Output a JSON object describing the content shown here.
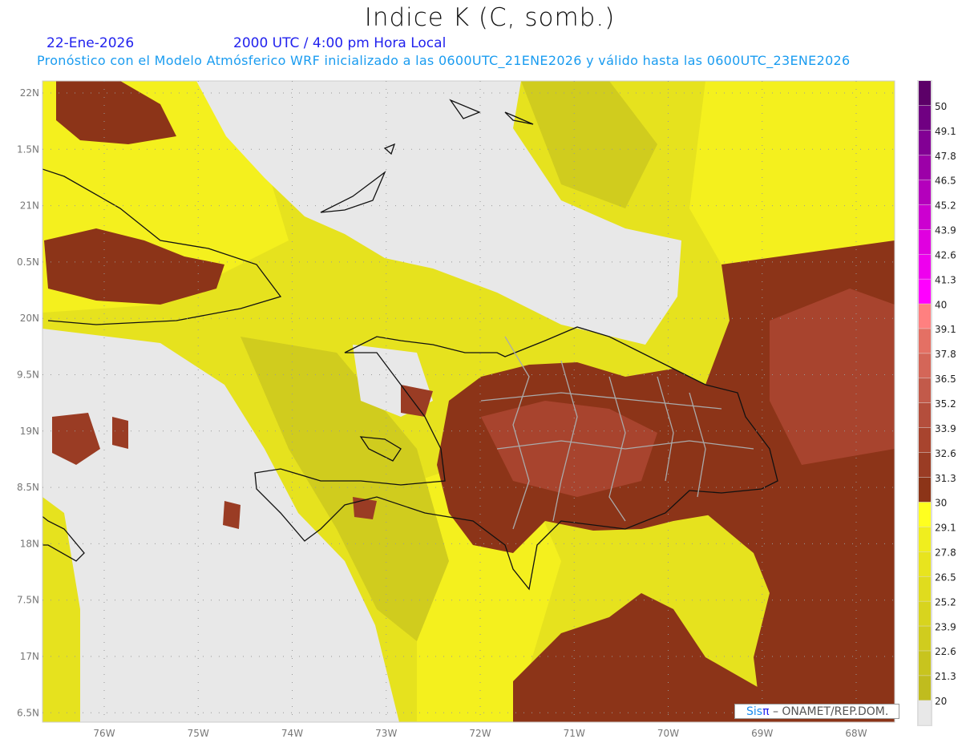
{
  "header": {
    "title": "Indice K (C, somb.)",
    "date": "22-Ene-2026",
    "time": "2000 UTC / 4:00 pm Hora Local",
    "subtitle": "Pronóstico con el Modelo Atmósferico WRF inicializado a las 0600UTC_21ENE2026 y válido hasta las  0600UTC_23ENE2026"
  },
  "map": {
    "lon_ticks": [
      {
        "value": -76,
        "label": "76W"
      },
      {
        "value": -75,
        "label": "75W"
      },
      {
        "value": -74,
        "label": "74W"
      },
      {
        "value": -73,
        "label": "73W"
      },
      {
        "value": -72,
        "label": "72W"
      },
      {
        "value": -71,
        "label": "71W"
      },
      {
        "value": -70,
        "label": "70W"
      },
      {
        "value": -69,
        "label": "69W"
      },
      {
        "value": -68,
        "label": "68W"
      }
    ],
    "lat_ticks": [
      {
        "value": 22,
        "label": "22N"
      },
      {
        "value": 21.5,
        "label": "1.5N"
      },
      {
        "value": 21,
        "label": "21N"
      },
      {
        "value": 20.5,
        "label": "0.5N"
      },
      {
        "value": 20,
        "label": "20N"
      },
      {
        "value": 19.5,
        "label": "9.5N"
      },
      {
        "value": 19,
        "label": "19N"
      },
      {
        "value": 18.5,
        "label": "8.5N"
      },
      {
        "value": 18,
        "label": "18N"
      },
      {
        "value": 17.5,
        "label": "7.5N"
      },
      {
        "value": 17,
        "label": "17N"
      },
      {
        "value": 16.5,
        "label": "6.5N"
      }
    ]
  },
  "colorbar": {
    "labels": [
      "20",
      "21.3",
      "22.6",
      "23.9",
      "25.2",
      "26.5",
      "27.8",
      "29.1",
      "30",
      "31.3",
      "32.6",
      "33.9",
      "35.2",
      "36.5",
      "37.8",
      "39.1",
      "40",
      "41.3",
      "42.6",
      "43.9",
      "45.2",
      "46.5",
      "47.8",
      "49.1",
      "50"
    ],
    "colors": [
      "#e8e8e8",
      "#c0bc1e",
      "#c8c41e",
      "#d0cc1e",
      "#d8d41e",
      "#e0dc1e",
      "#e8e41e",
      "#f0ee1e",
      "#ffff20",
      "#8c3418",
      "#9a3c24",
      "#a8442e",
      "#b44e3c",
      "#c25a4a",
      "#d46658",
      "#e47064",
      "#ff8080",
      "#ff00ff",
      "#ee00ee",
      "#e000e0",
      "#cc00d0",
      "#b400bc",
      "#9c00a8",
      "#820094",
      "#700082",
      "#5c0068"
    ]
  },
  "field_colors": {
    "below": "#e8e8e8",
    "yellow_dark": "#c8c41e",
    "yellow": "#e6e21e",
    "yellow_bright": "#ffff20",
    "brown": "#8c3418",
    "brown_light": "#a8442e"
  },
  "credit": {
    "brand_a": "Sis",
    "brand_b": "π",
    "text": " –  ONAMET/REP.DOM."
  }
}
